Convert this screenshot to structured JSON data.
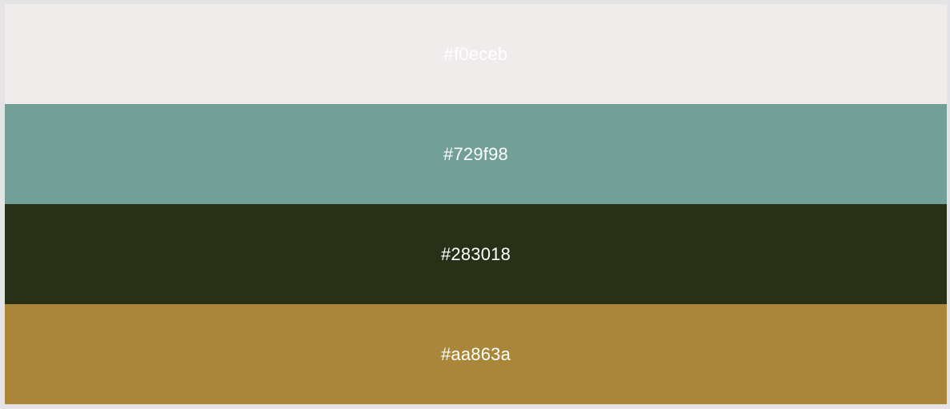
{
  "swatches": [
    {
      "hex": "#f0eceb",
      "label": "#f0eceb"
    },
    {
      "hex": "#729f98",
      "label": "#729f98"
    },
    {
      "hex": "#283018",
      "label": "#283018"
    },
    {
      "hex": "#aa863a",
      "label": "#aa863a"
    }
  ]
}
